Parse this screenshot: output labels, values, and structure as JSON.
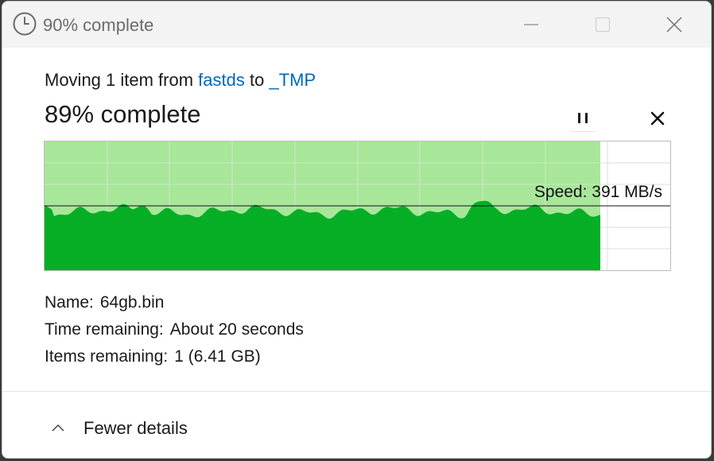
{
  "window": {
    "title": "90% complete",
    "icon": "clock-icon",
    "controls": {
      "minimize": "minimize-icon",
      "maximize": "maximize-icon",
      "close": "close-icon"
    }
  },
  "operation": {
    "prefix": "Moving 1 item from ",
    "source": "fastds",
    "middle": " to ",
    "destination": "_TMP",
    "progress_text": "89% complete",
    "progress_fraction": 0.89,
    "pause_icon": "pause-icon",
    "cancel_icon": "cancel-icon"
  },
  "graph": {
    "speed_text": "Speed: 391 MB/s",
    "fill_color_done": "#a8e69a",
    "fill_color_speed": "#06ae25",
    "grid_color": "#c9ecc1"
  },
  "details": {
    "name_label": "Name:",
    "name_value": "64gb.bin",
    "time_label": "Time remaining:",
    "time_value": "About 20 seconds",
    "items_label": "Items remaining:",
    "items_value": "1 (6.41 GB)"
  },
  "footer": {
    "toggle_label": "Fewer details",
    "toggle_icon": "chevron-up-icon"
  },
  "colors": {
    "link": "#0067c0",
    "titlebar_bg": "#f3f3f3"
  }
}
